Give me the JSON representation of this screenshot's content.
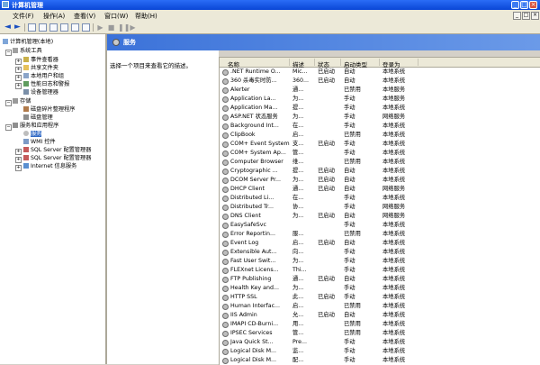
{
  "window": {
    "title": "计算机管理",
    "buttons": [
      "_",
      "□",
      "×"
    ]
  },
  "menu": {
    "items": [
      "文件(F)",
      "操作(A)",
      "查看(V)",
      "窗口(W)",
      "帮助(H)"
    ]
  },
  "tree": {
    "items": [
      {
        "label": "计算机管理(本地)",
        "icon": "computer-icon"
      },
      {
        "label": "系统工具",
        "icon": "tools-icon"
      },
      {
        "label": "事件查看器",
        "icon": "event-viewer-icon"
      },
      {
        "label": "共享文件夹",
        "icon": "folder-icon"
      },
      {
        "label": "本地用户和组",
        "icon": "users-icon"
      },
      {
        "label": "性能日志和警报",
        "icon": "performance-icon"
      },
      {
        "label": "设备管理器",
        "icon": "device-icon"
      },
      {
        "label": "存储",
        "icon": "storage-icon"
      },
      {
        "label": "磁盘碎片整理程序",
        "icon": "defrag-icon"
      },
      {
        "label": "磁盘管理",
        "icon": "disk-icon"
      },
      {
        "label": "服务和应用程序",
        "icon": "services-apps-icon"
      },
      {
        "label": "服务",
        "icon": "gear-icon"
      },
      {
        "label": "WMI 控件",
        "icon": "wmi-icon"
      },
      {
        "label": "SQL Server 配置管理器",
        "icon": "sql-icon"
      },
      {
        "label": "SQL Server 配置管理器",
        "icon": "sql-icon"
      },
      {
        "label": "Internet 信息服务",
        "icon": "iis-icon"
      }
    ]
  },
  "content": {
    "header": "服务",
    "description": "选择一个项目来查看它的描述。",
    "columns": [
      "名称",
      "描述",
      "状态",
      "启动类型",
      "登录为"
    ],
    "rows": [
      [
        ".NET Runtime O...",
        "Mic...",
        "已启动",
        "自动",
        "本地系统"
      ],
      [
        "360 杀毒实时防...",
        "360...",
        "已启动",
        "自动",
        "本地系统"
      ],
      [
        "Alerter",
        "通...",
        "",
        "已禁用",
        "本地服务"
      ],
      [
        "Application La...",
        "为...",
        "",
        "手动",
        "本地服务"
      ],
      [
        "Application Ma...",
        "提...",
        "",
        "手动",
        "本地系统"
      ],
      [
        "ASP.NET 状态服务",
        "为...",
        "",
        "手动",
        "网络服务"
      ],
      [
        "Background Int...",
        "在...",
        "",
        "手动",
        "本地系统"
      ],
      [
        "ClipBook",
        "启...",
        "",
        "已禁用",
        "本地系统"
      ],
      [
        "COM+ Event System",
        "支...",
        "已启动",
        "手动",
        "本地系统"
      ],
      [
        "COM+ System Ap...",
        "管...",
        "",
        "手动",
        "本地系统"
      ],
      [
        "Computer Browser",
        "维...",
        "",
        "已禁用",
        "本地系统"
      ],
      [
        "Cryptographic ...",
        "提...",
        "已启动",
        "自动",
        "本地系统"
      ],
      [
        "DCOM Server Pr...",
        "为...",
        "已启动",
        "自动",
        "本地系统"
      ],
      [
        "DHCP Client",
        "通...",
        "已启动",
        "自动",
        "网络服务"
      ],
      [
        "Distributed Li...",
        "在...",
        "",
        "手动",
        "本地系统"
      ],
      [
        "Distributed Tr...",
        "协...",
        "",
        "手动",
        "网络服务"
      ],
      [
        "DNS Client",
        "为...",
        "已启动",
        "自动",
        "网络服务"
      ],
      [
        "EasySafeSvc",
        "",
        "",
        "手动",
        "本地系统"
      ],
      [
        "Error Reportin...",
        "服...",
        "",
        "已禁用",
        "本地系统"
      ],
      [
        "Event Log",
        "启...",
        "已启动",
        "自动",
        "本地系统"
      ],
      [
        "Extensible Aut...",
        "向...",
        "",
        "手动",
        "本地系统"
      ],
      [
        "Fast User Swit...",
        "为...",
        "",
        "手动",
        "本地系统"
      ],
      [
        "FLEXnet Licens...",
        "Thi...",
        "",
        "手动",
        "本地系统"
      ],
      [
        "FTP Publishing",
        "通...",
        "已启动",
        "自动",
        "本地系统"
      ],
      [
        "Health Key and...",
        "为...",
        "",
        "手动",
        "本地系统"
      ],
      [
        "HTTP SSL",
        "此...",
        "已启动",
        "手动",
        "本地系统"
      ],
      [
        "Human Interfac...",
        "启...",
        "",
        "已禁用",
        "本地系统"
      ],
      [
        "IIS Admin",
        "允...",
        "已启动",
        "自动",
        "本地系统"
      ],
      [
        "IMAPI CD-Burni...",
        "用...",
        "",
        "已禁用",
        "本地系统"
      ],
      [
        "IPSEC Services",
        "管...",
        "",
        "已禁用",
        "本地系统"
      ],
      [
        "Java Quick St...",
        "Pre...",
        "",
        "手动",
        "本地系统"
      ],
      [
        "Logical Disk M...",
        "监...",
        "",
        "手动",
        "本地系统"
      ],
      [
        "Logical Disk M...",
        "配...",
        "",
        "手动",
        "本地系统"
      ]
    ]
  }
}
